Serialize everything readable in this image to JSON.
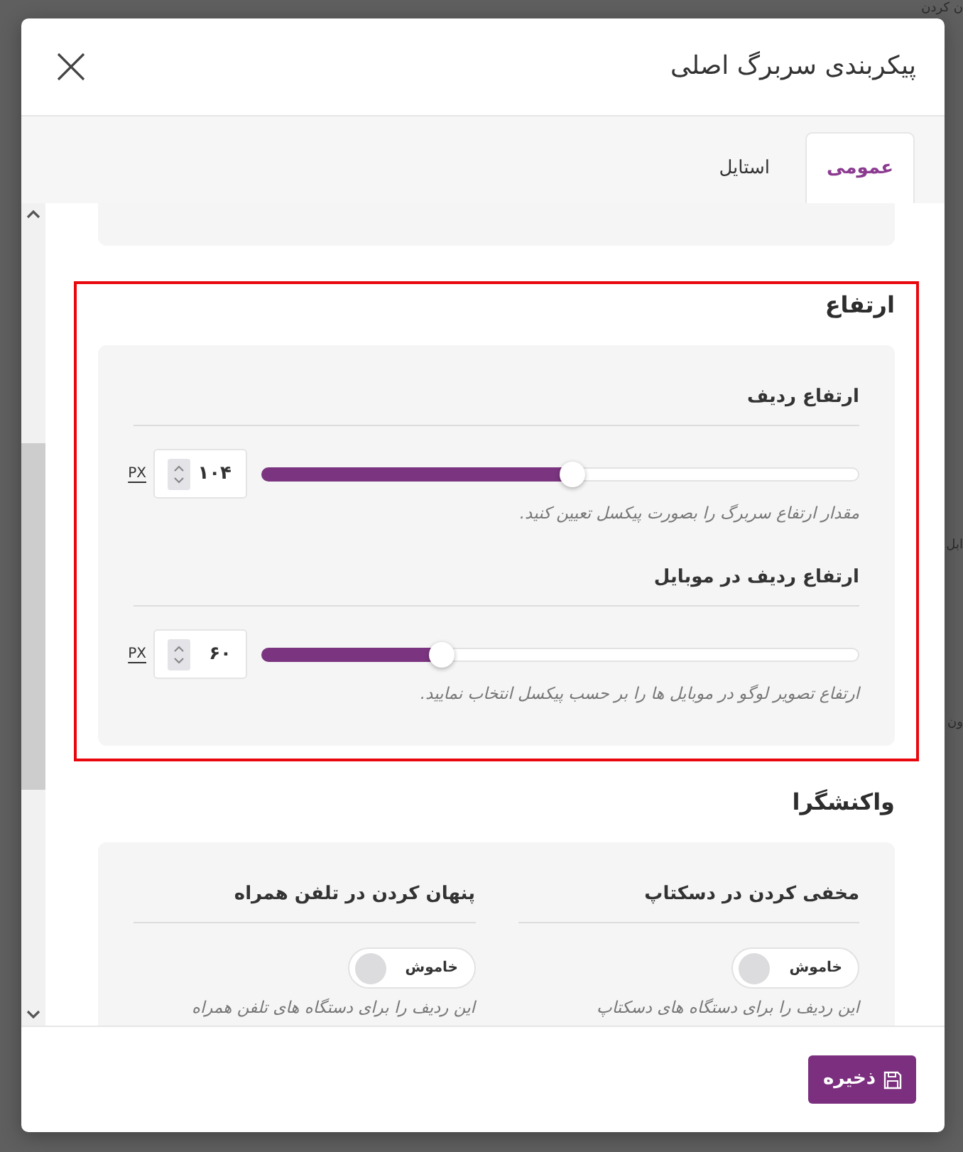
{
  "backdrop": {
    "texts": [
      "ن کردن",
      "ابل",
      "ون"
    ]
  },
  "dialog": {
    "title": "پیکربندی سربرگ اصلی"
  },
  "tabs": [
    {
      "label": "عمومی",
      "selected": true
    },
    {
      "label": "استایل",
      "selected": false
    }
  ],
  "sections": [
    {
      "kind": "sliders",
      "heading": "ارتفاع",
      "highlighted": true,
      "fields": [
        {
          "label": "ارتفاع ردیف",
          "value": "۱۰۴",
          "unit": "PX",
          "level": 0.52,
          "help": "مقدار ارتفاع سربرگ را بصورت پیکسل تعیین کنید."
        },
        {
          "label": "ارتفاع ردیف در موبایل",
          "value": "۶۰",
          "unit": "PX",
          "level": 0.3,
          "help": "ارتفاع تصویر لوگو در موبایل ها را بر حسب پیکسل انتخاب نمایید."
        }
      ]
    },
    {
      "kind": "toggles",
      "heading": "واکنشگرا",
      "fields": [
        {
          "label": "مخفی کردن در دسکتاپ",
          "on": false,
          "state_label": "خاموش",
          "help": "این ردیف را برای دستگاه های دسکتاپ"
        },
        {
          "label": "پنهان کردن در تلفن همراه",
          "on": false,
          "state_label": "خاموش",
          "help": "این ردیف را برای دستگاه های تلفن همراه"
        }
      ]
    }
  ],
  "footer": {
    "save_button": "ذخیره"
  }
}
